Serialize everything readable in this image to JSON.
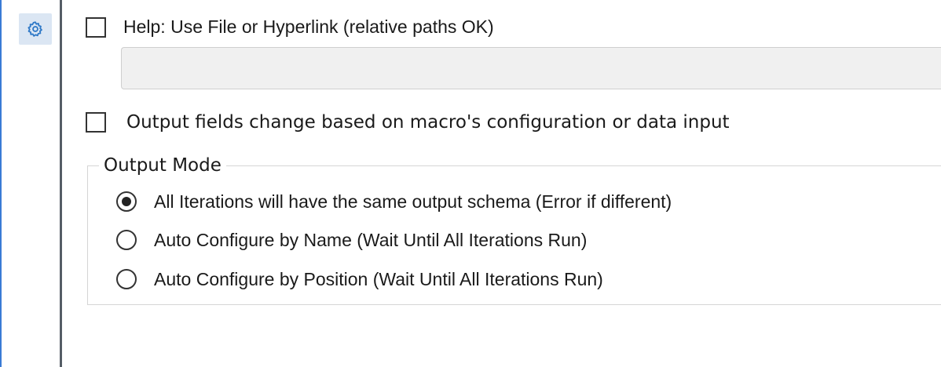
{
  "help": {
    "checkbox_checked": false,
    "label": "Help: Use File or Hyperlink (relative paths OK)",
    "input_value": ""
  },
  "output_fields": {
    "checkbox_checked": false,
    "label": "Output fields change based on macro's configuration or data input"
  },
  "output_mode": {
    "legend": "Output Mode",
    "options": [
      {
        "label": "All Iterations will have the same output schema (Error if different)",
        "selected": true
      },
      {
        "label": "Auto Configure by Name (Wait Until All Iterations Run)",
        "selected": false
      },
      {
        "label": "Auto Configure by Position (Wait Until All Iterations Run)",
        "selected": false
      }
    ]
  },
  "sidebar": {
    "active_icon": "gear-icon",
    "accent_color": "#3a7bd5"
  }
}
